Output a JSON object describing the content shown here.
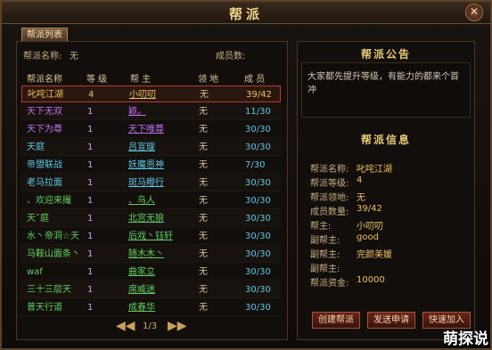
{
  "window": {
    "title": "帮派",
    "close_label": "✕"
  },
  "tab_label": "帮派列表",
  "info": {
    "guild_name_label": "帮派名称:",
    "guild_name_value": "无",
    "member_count_label": "成员数:"
  },
  "columns": [
    "帮派名称",
    "等 级",
    "帮 主",
    "领 地",
    "成 员"
  ],
  "rows": [
    {
      "name": "叱咤江湖",
      "name_color": "#f0c060",
      "level": "4",
      "leader": "小叨叨",
      "leader_color": "#f0c060",
      "land": "无",
      "members": "39/42",
      "mem_color": "#f0c060"
    },
    {
      "name": "天下无双",
      "name_color": "#c070f0",
      "level": "1",
      "leader": "颖。",
      "leader_color": "#c070f0",
      "land": "无",
      "members": "11/30",
      "mem_color": "#5cc8e8"
    },
    {
      "name": "天下为尊",
      "name_color": "#c070f0",
      "level": "1",
      "leader": "天下唯尊",
      "leader_color": "#c070f0",
      "land": "无",
      "members": "30/30",
      "mem_color": "#5cc8e8"
    },
    {
      "name": "天庭",
      "name_color": "#5cc8e8",
      "level": "1",
      "leader": "吕宣璇",
      "leader_color": "#5cc8e8",
      "land": "无",
      "members": "30/30",
      "mem_color": "#5cc8e8"
    },
    {
      "name": "帝盟联战",
      "name_color": "#5cc8e8",
      "level": "1",
      "leader": "妖魔恩神",
      "leader_color": "#5cc8e8",
      "land": "无",
      "members": "7/30",
      "mem_color": "#5cc8e8"
    },
    {
      "name": "老马拉面",
      "name_color": "#5cc8e8",
      "level": "1",
      "leader": "斑马瞪行",
      "leader_color": "#5cc8e8",
      "land": "无",
      "members": "30/30",
      "mem_color": "#5cc8e8"
    },
    {
      "name": "、欢迎来撮",
      "name_color": "#60d060",
      "level": "1",
      "leader": "、鸟人",
      "leader_color": "#60d060",
      "land": "无",
      "members": "30/30",
      "mem_color": "#5cc8e8"
    },
    {
      "name": "天ˇ庭",
      "name_color": "#60d060",
      "level": "1",
      "leader": "北宫无狼",
      "leader_color": "#60d060",
      "land": "无",
      "members": "30/30",
      "mem_color": "#5cc8e8"
    },
    {
      "name": "水丶帝洞☆天",
      "name_color": "#60d060",
      "level": "1",
      "leader": "后戏丶钰轩",
      "leader_color": "#60d060",
      "land": "无",
      "members": "30/30",
      "mem_color": "#5cc8e8"
    },
    {
      "name": "马鞍山面条丶",
      "name_color": "#60d060",
      "level": "1",
      "leader": "随木木丶",
      "leader_color": "#60d060",
      "land": "无",
      "members": "30/30",
      "mem_color": "#5cc8e8"
    },
    {
      "name": "waf",
      "name_color": "#60d060",
      "level": "1",
      "leader": "曲家立",
      "leader_color": "#60d060",
      "land": "无",
      "members": "30/30",
      "mem_color": "#5cc8e8"
    },
    {
      "name": "三十三层天",
      "name_color": "#60d060",
      "level": "1",
      "leader": "席威迷",
      "leader_color": "#60d060",
      "land": "无",
      "members": "30/30",
      "mem_color": "#5cc8e8"
    },
    {
      "name": "普天行道",
      "name_color": "#60d060",
      "level": "1",
      "leader": "成春华",
      "leader_color": "#60d060",
      "land": "无",
      "members": "30/30",
      "mem_color": "#5cc8e8"
    }
  ],
  "pager": {
    "prev": "◀◀",
    "page": "1/3",
    "next": "▶▶"
  },
  "announcement": {
    "title": "帮派公告",
    "text": "大家都先提升等级，有能力的都来个首冲"
  },
  "guild_info": {
    "title": "帮派信息",
    "items": [
      {
        "label": "帮派名称:",
        "value": "叱咤江湖",
        "color": "#f0c060"
      },
      {
        "label": "帮派等级:",
        "value": "4",
        "color": "#f0c060"
      },
      {
        "label": "帮派领地:",
        "value": "无",
        "color": "#f0c060"
      },
      {
        "label": "成员数量:",
        "value": "39/42",
        "color": "#f0c060"
      },
      {
        "label": "帮主:",
        "value": "小叨叨",
        "color": "#f0c060"
      },
      {
        "label": "副帮主:",
        "value": "good",
        "color": "#f0c060"
      },
      {
        "label": "副帮主:",
        "value": "完颜美媛",
        "color": "#f0c060"
      },
      {
        "label": "副帮主:",
        "value": "",
        "color": "#f0c060"
      },
      {
        "label": "帮派资金:",
        "value": "10000",
        "color": "#f0c060"
      }
    ]
  },
  "buttons": {
    "create": "创建帮派",
    "apply": "发送申请",
    "quick_join": "快速加入"
  },
  "watermark": "萌探说"
}
